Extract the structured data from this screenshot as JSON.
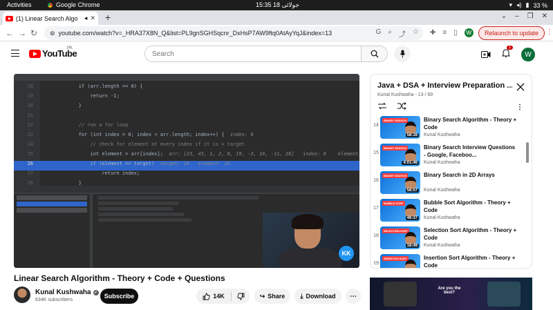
{
  "os": {
    "activities": "Activities",
    "app_name": "Google Chrome",
    "clock": "15:35  18 جولائی",
    "battery": "33 %"
  },
  "browser": {
    "tab_title": "(1) Linear Search Algo",
    "url": "youtube.com/watch?v=_HRA37X8N_Q&list=PL9gnSGHSqcnr_DxHsP7AW9ftq0AtAyYqJ&index=13",
    "profile_initial": "W",
    "relaunch_label": "Relaunch to update"
  },
  "yt_header": {
    "logo_text": "YouTube",
    "region": "PK",
    "search_placeholder": "Search",
    "notification_count": "1",
    "avatar_initial": "W"
  },
  "player": {
    "code_lines": [
      {
        "n": "18",
        "text": "        if (arr.length == 0) {"
      },
      {
        "n": "19",
        "text": "            return -1;"
      },
      {
        "n": "20",
        "text": "        }"
      },
      {
        "n": "21",
        "text": ""
      },
      {
        "n": "22",
        "text": "        // run a for loop"
      },
      {
        "n": "23",
        "text": "        for (int index = 0; index < arr.length; index++) {",
        "hint": "  index: 0"
      },
      {
        "n": "24",
        "text": "            // check for element at every index if it is = target"
      },
      {
        "n": "25",
        "text": "            int element = arr[index];",
        "hint": "  arr: [23, 45, 1, 2, 8, 19, -3, 16, -11, 28]   index: 0    element: 23"
      },
      {
        "n": "26",
        "text": "            if (element == target)",
        "hint": "  target: 19   element: 23",
        "highlight": true
      },
      {
        "n": "27",
        "text": "                return index;"
      },
      {
        "n": "28",
        "text": "        }"
      },
      {
        "n": "29",
        "text": "        // this line will execute if none of the return statements above have executed"
      }
    ],
    "webcam_badge": "KK"
  },
  "video": {
    "title": "Linear Search Algorithm - Theory + Code + Questions",
    "channel": "Kunal Kushwaha",
    "subscribers": "634K subscribers",
    "subscribe_label": "Subscribe",
    "likes": "14K",
    "share_label": "Share",
    "download_label": "Download"
  },
  "playlist": {
    "title": "Java + DSA + Interview Preparation ...",
    "subtitle": "Kunal Kushwaha - 13 / 69",
    "items": [
      {
        "index": "14",
        "title": "Binary Search Algorithm - Theory + Code",
        "author": "Kunal Kushwaha",
        "duration": "58:16",
        "thumb_label": "BINARY SEARCH"
      },
      {
        "index": "15",
        "title": "Binary Search Interview Questions - Google, Faceboo...",
        "author": "Kunal Kushwaha",
        "duration": "4:01:46",
        "thumb_label": "BINARY SEARCH"
      },
      {
        "index": "16",
        "title": "Binary Search in 2D Arrays",
        "author": "Kunal Kushwaha",
        "duration": "58:57",
        "thumb_label": "BINARY SEARCH"
      },
      {
        "index": "17",
        "title": "Bubble Sort Algorithm - Theory + Code",
        "author": "Kunal Kushwaha",
        "duration": "46:37",
        "thumb_label": "BUBBLE SORT"
      },
      {
        "index": "18",
        "title": "Selection Sort Algorithm - Theory + Code",
        "author": "Kunal Kushwaha",
        "duration": "18:49",
        "thumb_label": "SELECTION SORT"
      },
      {
        "index": "19",
        "title": "Insertion Sort Algorithm - Theory + Code",
        "author": "Kunal Kushwaha",
        "duration": "",
        "thumb_label": "INSERTION SORT"
      }
    ]
  },
  "banner": {
    "text": "Are you the best?"
  }
}
